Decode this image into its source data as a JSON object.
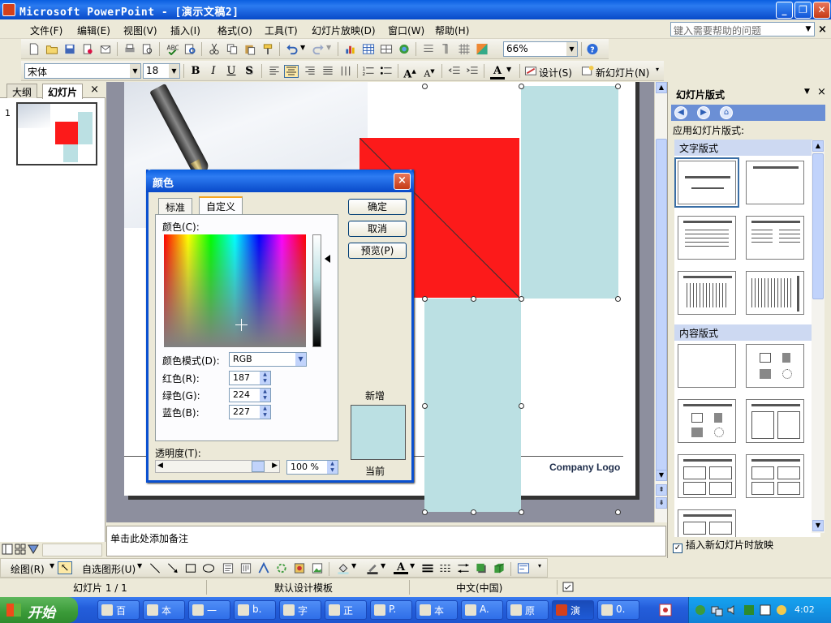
{
  "window": {
    "title": "Microsoft PowerPoint - [演示文稿2]",
    "minimize": "_",
    "restore": "❐",
    "close": "✕"
  },
  "menu": {
    "items": [
      "文件(F)",
      "编辑(E)",
      "视图(V)",
      "插入(I)",
      "格式(O)",
      "工具(T)",
      "幻灯片放映(D)",
      "窗口(W)",
      "帮助(H)"
    ],
    "help_placeholder": "键入需要帮助的问题",
    "mdi_close": "×"
  },
  "toolbar_standard": {
    "zoom": "66%"
  },
  "toolbar_format": {
    "font": "宋体",
    "font_size": "18",
    "bold": "B",
    "italic": "I",
    "underline": "U",
    "shadow": "S",
    "font_color": "A",
    "design_label": "设计(S)",
    "new_slide_label": "新幻灯片(N)"
  },
  "left_pane": {
    "tabs": [
      "大纲",
      "幻灯片"
    ],
    "close": "×",
    "slide_number": "1"
  },
  "slide": {
    "company_logo": "Company Logo",
    "colors": {
      "red": "#fc1a1a",
      "light_blue": "#bbe0e3"
    }
  },
  "notes": {
    "placeholder": "单击此处添加备注"
  },
  "task_pane": {
    "title": "幻灯片版式",
    "apply_label": "应用幻灯片版式:",
    "section_text": "文字版式",
    "section_content": "内容版式",
    "insert_checkbox": "插入新幻灯片时放映",
    "close": "×"
  },
  "drawing_toolbar": {
    "draw_label": "绘图(R)",
    "autoshapes_label": "自选图形(U)"
  },
  "status": {
    "slide": "幻灯片 1 / 1",
    "template": "默认设计模板",
    "language": "中文(中国)"
  },
  "taskbar": {
    "start_label": "开始",
    "buttons": [
      "百",
      "本",
      "一",
      "b.",
      "字",
      "正",
      "P.",
      "本",
      "A.",
      "原",
      "演",
      "0."
    ],
    "clock": "4:02"
  },
  "dialog": {
    "title": "颜色",
    "close": "×",
    "tabs": [
      "标准",
      "自定义"
    ],
    "colors_label": "颜色(C):",
    "mode_label": "颜色模式(D):",
    "mode_value": "RGB",
    "red_label": "红色(R):",
    "red_value": "187",
    "green_label": "绿色(G):",
    "green_value": "224",
    "blue_label": "蓝色(B):",
    "blue_value": "227",
    "transparency_label": "透明度(T):",
    "transparency_value": "100 %",
    "ok": "确定",
    "cancel": "取消",
    "preview": "预览(P)",
    "new_label": "新增",
    "current_label": "当前",
    "new_color": "#bbe0e3",
    "current_color": "#bbe0e3"
  }
}
